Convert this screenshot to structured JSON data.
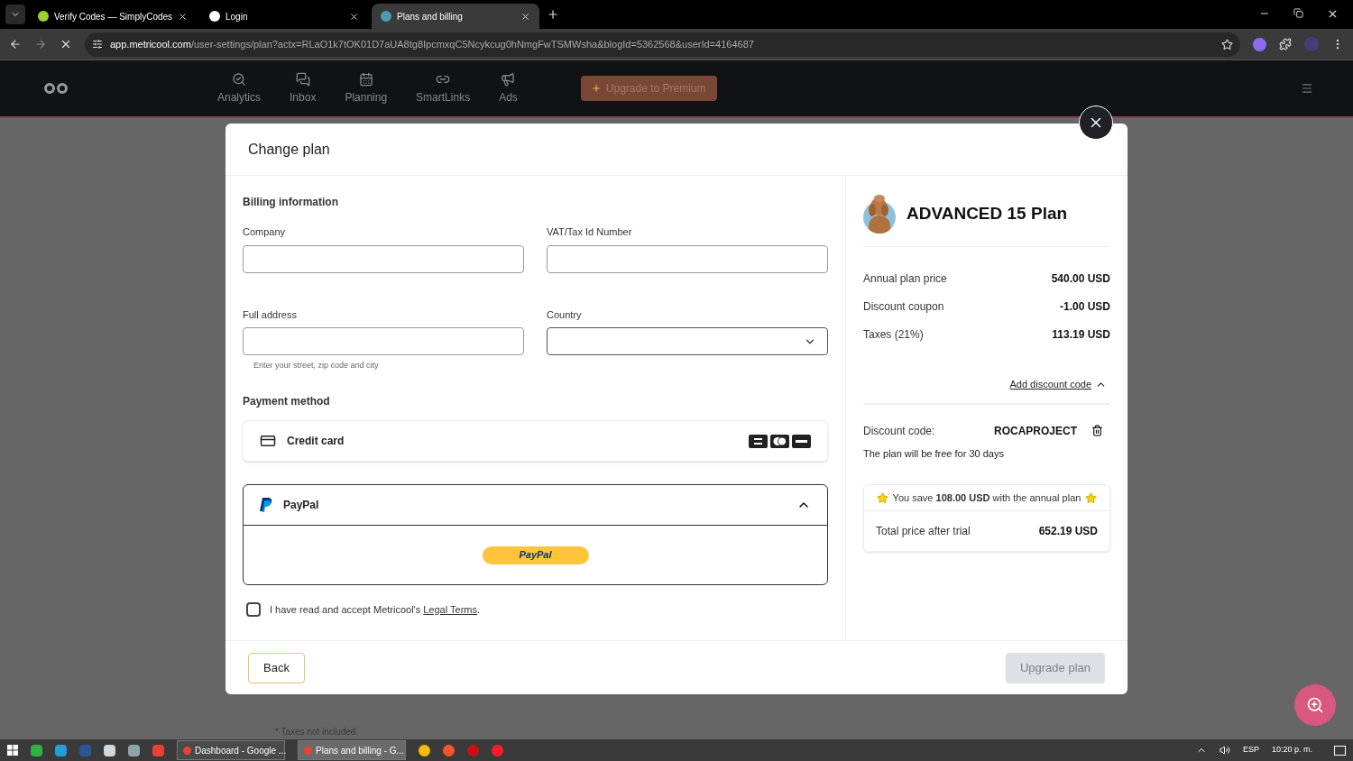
{
  "browser": {
    "tabs": [
      {
        "title": "Verify Codes — SimplyCodes",
        "selected": false
      },
      {
        "title": "Login",
        "selected": false
      },
      {
        "title": "Plans and billing",
        "selected": true
      }
    ],
    "url_host": "app.metricool.com",
    "url_path": "/user-settings/plan?actx=RLaO1k7tOK01D7aUA8tg8IpcmxqC5Ncykcug0hNmgFwTSMWsha&blogId=5362568&userId=4164687"
  },
  "nav": {
    "items": [
      {
        "label": "Analytics"
      },
      {
        "label": "Inbox"
      },
      {
        "label": "Planning"
      },
      {
        "label": "SmartLinks"
      },
      {
        "label": "Ads"
      }
    ],
    "upgrade_button": "Upgrade to Premium"
  },
  "background_note": "* Taxes not included",
  "modal": {
    "title": "Change plan",
    "billing": {
      "heading": "Billing information",
      "fields": [
        {
          "label": "Company",
          "kind": "text"
        },
        {
          "label": "VAT/Tax Id Number",
          "kind": "text"
        },
        {
          "label": "Full address",
          "kind": "text",
          "hint": "Enter your street, zip code and city"
        },
        {
          "label": "Country",
          "kind": "select"
        }
      ]
    },
    "payment": {
      "heading": "Payment method",
      "methods": [
        {
          "kind": "card",
          "label": "Credit card",
          "expanded": false
        },
        {
          "kind": "paypal",
          "label": "PayPal",
          "expanded": true,
          "button": "PayPal"
        }
      ]
    },
    "terms": {
      "checked": false,
      "text": "I have read and accept Metricool's ",
      "link": "Legal Terms",
      "after": "."
    },
    "summary": {
      "plan": "ADVANCED 15 Plan",
      "lines": [
        {
          "label": "Annual plan price",
          "value": "540.00 USD"
        },
        {
          "label": "Discount coupon",
          "value": "-1.00 USD"
        },
        {
          "label": "Taxes (21%)",
          "value": "113.19 USD"
        }
      ],
      "discount_toggle": {
        "label": "Add discount code",
        "expanded": true
      },
      "discount": {
        "label": "Discount code:",
        "code": "ROCAPROJECT",
        "note": "The plan will be free for 30 days"
      },
      "savings": "You save **108.00 USD** with the annual plan",
      "total": {
        "label": "Total price after trial",
        "value": "652.19 USD"
      }
    },
    "back_button": "Back",
    "upgrade_button": {
      "label": "Upgrade plan",
      "disabled": true
    }
  },
  "taskbar": {
    "windows": [
      {
        "label": "Dashboard - Google ...",
        "selected": false
      },
      {
        "label": "Plans and billing - G...",
        "selected": true
      }
    ],
    "language": "ESP",
    "clock": "10:20 p. m."
  }
}
